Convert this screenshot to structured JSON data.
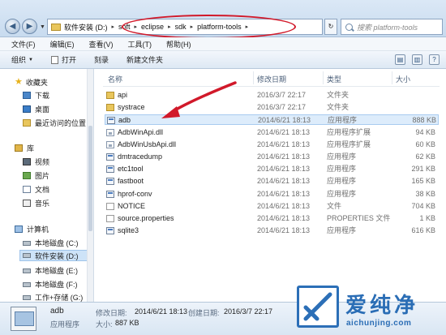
{
  "address": {
    "crumbs": [
      "软件安装 (D:)",
      "soft",
      "eclipse",
      "sdk",
      "platform-tools"
    ],
    "search_placeholder": "搜索 platform-tools"
  },
  "menubar": [
    "文件(F)",
    "编辑(E)",
    "查看(V)",
    "工具(T)",
    "帮助(H)"
  ],
  "toolbar": {
    "organize": "组织",
    "open": "打开",
    "burn": "刻录",
    "new_folder": "新建文件夹"
  },
  "nav": {
    "favorites": "收藏夹",
    "downloads": "下载",
    "desktop": "桌面",
    "recent": "最近访问的位置",
    "libraries": "库",
    "videos": "视频",
    "pictures": "图片",
    "documents": "文档",
    "music": "音乐",
    "computer": "计算机",
    "drive_c": "本地磁盘 (C:)",
    "drive_d": "软件安装 (D:)",
    "drive_e": "本地磁盘 (E:)",
    "drive_f": "本地磁盘 (F:)",
    "drive_g": "工作+存储 (G:)"
  },
  "columns": {
    "name": "名称",
    "date": "修改日期",
    "type": "类型",
    "size": "大小"
  },
  "files": [
    {
      "name": "api",
      "date": "2016/3/7 22:17",
      "type": "文件夹",
      "size": "",
      "icon": "folder"
    },
    {
      "name": "systrace",
      "date": "2016/3/7 22:17",
      "type": "文件夹",
      "size": "",
      "icon": "folder"
    },
    {
      "name": "adb",
      "date": "2014/6/21 18:13",
      "type": "应用程序",
      "size": "888 KB",
      "icon": "exe"
    },
    {
      "name": "AdbWinApi.dll",
      "date": "2014/6/21 18:13",
      "type": "应用程序扩展",
      "size": "94 KB",
      "icon": "dll"
    },
    {
      "name": "AdbWinUsbApi.dll",
      "date": "2014/6/21 18:13",
      "type": "应用程序扩展",
      "size": "60 KB",
      "icon": "dll"
    },
    {
      "name": "dmtracedump",
      "date": "2014/6/21 18:13",
      "type": "应用程序",
      "size": "62 KB",
      "icon": "exe"
    },
    {
      "name": "etc1tool",
      "date": "2014/6/21 18:13",
      "type": "应用程序",
      "size": "291 KB",
      "icon": "exe"
    },
    {
      "name": "fastboot",
      "date": "2014/6/21 18:13",
      "type": "应用程序",
      "size": "165 KB",
      "icon": "exe"
    },
    {
      "name": "hprof-conv",
      "date": "2014/6/21 18:13",
      "type": "应用程序",
      "size": "38 KB",
      "icon": "exe"
    },
    {
      "name": "NOTICE",
      "date": "2014/6/21 18:13",
      "type": "文件",
      "size": "704 KB",
      "icon": "file"
    },
    {
      "name": "source.properties",
      "date": "2014/6/21 18:13",
      "type": "PROPERTIES 文件",
      "size": "1 KB",
      "icon": "file"
    },
    {
      "name": "sqlite3",
      "date": "2014/6/21 18:13",
      "type": "应用程序",
      "size": "616 KB",
      "icon": "exe"
    }
  ],
  "details": {
    "name": "adb",
    "type": "应用程序",
    "modified_label": "修改日期:",
    "modified": "2014/6/21 18:13",
    "created_label": "创建日期:",
    "created": "2016/3/7 22:17",
    "size_label": "大小:",
    "size": "887 KB"
  },
  "watermark": {
    "text": "爱纯净",
    "url": "aichunjing.com"
  },
  "colors": {
    "highlight": "#d1192a",
    "selection": "#ddecfb",
    "watermark": "#2a6db5"
  }
}
